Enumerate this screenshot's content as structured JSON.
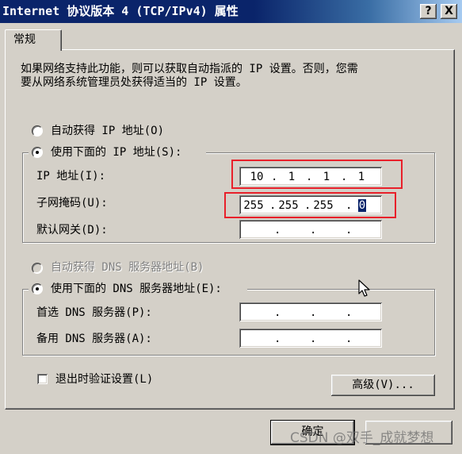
{
  "window": {
    "title": "Internet 协议版本 4 (TCP/IPv4) 属性",
    "help_label": "?",
    "close_label": "X"
  },
  "tabs": [
    {
      "label": "常规",
      "active": true
    }
  ],
  "description": [
    "如果网络支持此功能，则可以获取自动指派的 IP 设置。否则，您需",
    "要从网络系统管理员处获得适当的 IP 设置。"
  ],
  "ip": {
    "auto_label": "自动获得 IP 地址(O)",
    "manual_label": "使用下面的 IP 地址(S):",
    "selected": "manual",
    "separator": ".",
    "fields": [
      {
        "label": "IP 地址(I):",
        "octets": [
          "10",
          "1",
          "1",
          "1"
        ]
      },
      {
        "label": "子网掩码(U):",
        "octets": [
          "255",
          "255",
          "255",
          "0"
        ]
      },
      {
        "label": "默认网关(D):",
        "octets": [
          "",
          "",
          "",
          ""
        ]
      }
    ]
  },
  "dns": {
    "auto_label": "自动获得 DNS 服务器地址(B)",
    "auto_disabled": true,
    "manual_label": "使用下面的 DNS 服务器地址(E):",
    "selected": "manual",
    "fields": [
      {
        "label": "首选 DNS 服务器(P):",
        "octets": [
          "",
          "",
          "",
          ""
        ]
      },
      {
        "label": "备用 DNS 服务器(A):",
        "octets": [
          "",
          "",
          "",
          ""
        ]
      }
    ]
  },
  "validate": {
    "label": "退出时验证设置(L)",
    "checked": false
  },
  "advanced_label": "高级(V)...",
  "ok_label": "确定",
  "cancel_label": "",
  "watermark": "CSDN @双手_成就梦想",
  "colors": {
    "titlebar": "#0a246a",
    "face": "#d4d0c8",
    "annotation": "#e8202a",
    "selection": "#0a246a"
  }
}
